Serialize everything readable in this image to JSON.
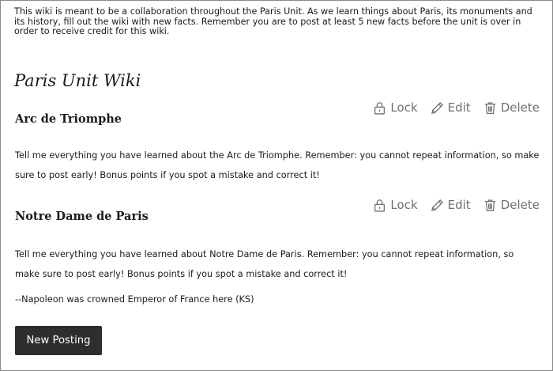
{
  "intro": "This wiki is meant to be a collaboration throughout the Paris Unit. As we learn things about Paris, its monuments and its history, fill out the wiki with new facts. Remember you are to post at least 5 new facts before the unit is over in order to receive credit for this wiki.",
  "page_title": "Paris Unit Wiki",
  "actions": {
    "lock": "Lock",
    "edit": "Edit",
    "delete": "Delete"
  },
  "entries": [
    {
      "title": "Arc de Triomphe",
      "body": "Tell me everything you have learned about the Arc de Triomphe. Remember: you cannot repeat information, so make sure to post early! Bonus points if you spot a mistake and correct it!"
    },
    {
      "title": "Notre Dame de Paris",
      "body": "Tell me everything you have learned about Notre Dame de Paris. Remember: you cannot repeat information, so make sure to post early! Bonus points if you spot a mistake and correct it!",
      "note": "--Napoleon was crowned Emperor of France here (KS)"
    }
  ],
  "new_posting_label": "New Posting",
  "icons": {
    "lock": "lock-icon",
    "edit": "pencil-icon",
    "delete": "trash-icon"
  }
}
